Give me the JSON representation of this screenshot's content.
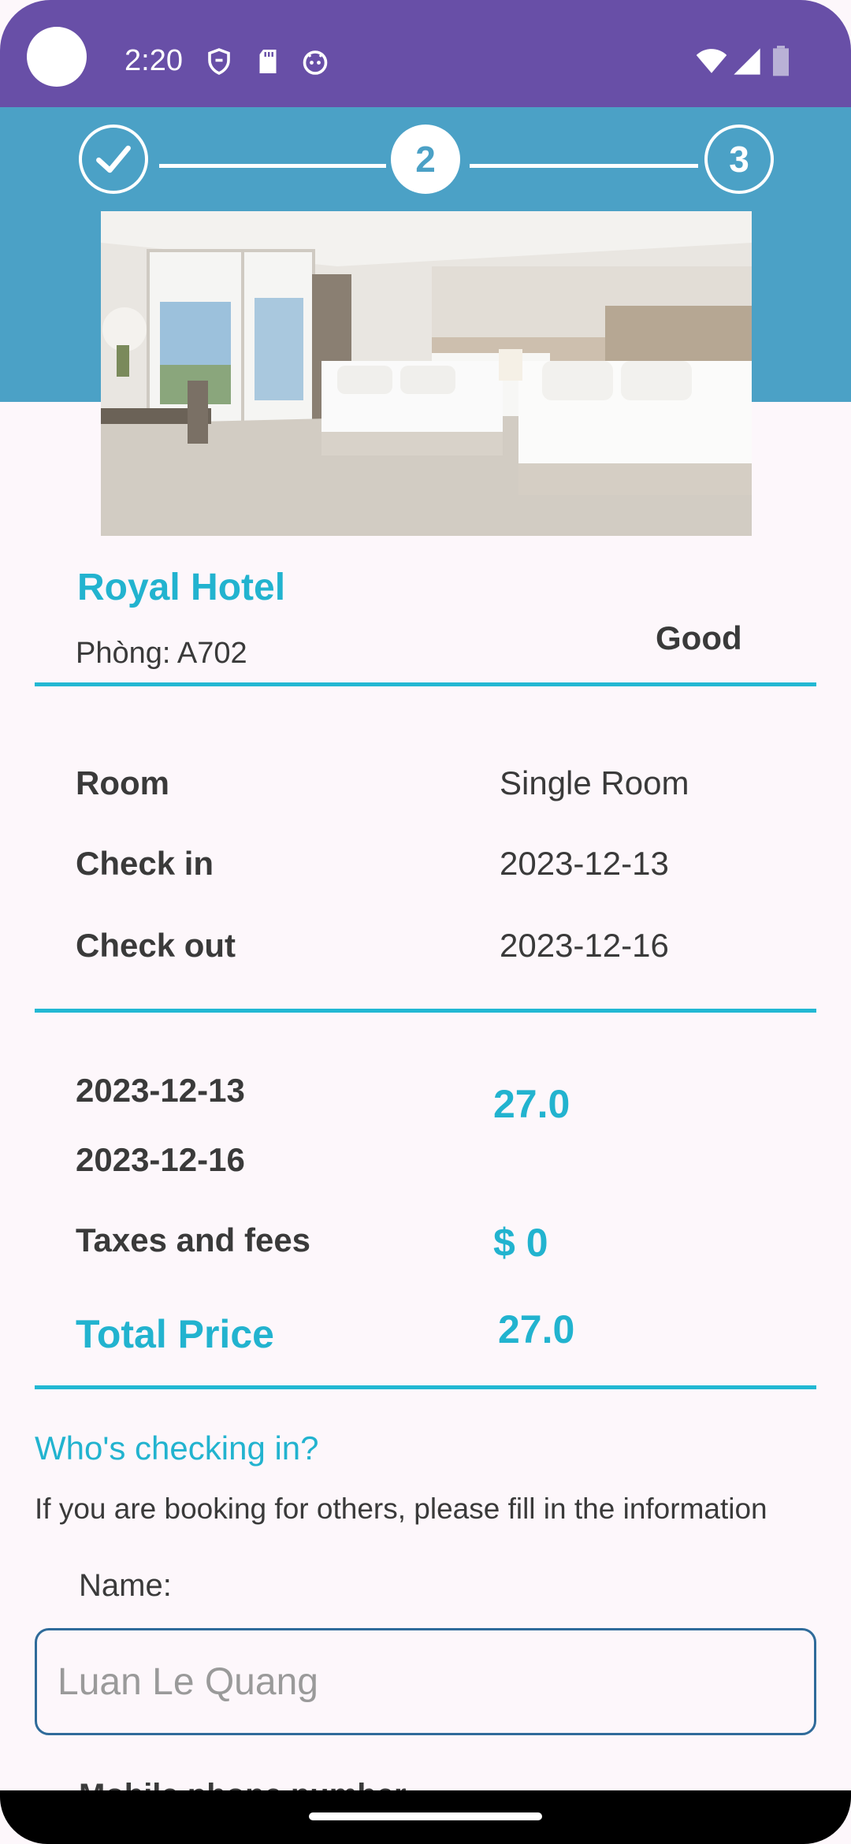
{
  "status_bar": {
    "time": "2:20",
    "icons": [
      "shield-icon",
      "sd-card-icon",
      "android-icon",
      "wifi-icon",
      "signal-icon",
      "battery-icon"
    ]
  },
  "stepper": {
    "steps": [
      {
        "label": "",
        "state": "completed",
        "icon": "check-icon"
      },
      {
        "label": "2",
        "state": "active"
      },
      {
        "label": "3",
        "state": "pending"
      }
    ]
  },
  "hotel": {
    "image": "hotel-room-photo",
    "name": "Royal Hotel",
    "room_code": "Phòng: A702",
    "rating": "Good"
  },
  "booking": {
    "room_label": "Room",
    "room_value": "Single Room",
    "checkin_label": "Check in",
    "checkin_value": "2023-12-13",
    "checkout_label": "Check out",
    "checkout_value": "2023-12-16"
  },
  "pricing": {
    "date_from": "2023-12-13",
    "date_to": "2023-12-16",
    "nights_price": "27.0",
    "taxes_label": "Taxes and fees",
    "taxes_value": "$ 0",
    "total_label": "Total Price",
    "total_value": "27.0"
  },
  "guest": {
    "section_title": "Who's checking in?",
    "description": "If you are booking for others, please fill in the information",
    "name_label": "Name:",
    "name_placeholder": "Luan Le Quang",
    "next_label_partial": "Mobile phone number"
  },
  "colors": {
    "status_bar": "#684fa7",
    "header_band": "#4ba1c6",
    "accent": "#22b3cf",
    "background": "#fdf7fb"
  }
}
